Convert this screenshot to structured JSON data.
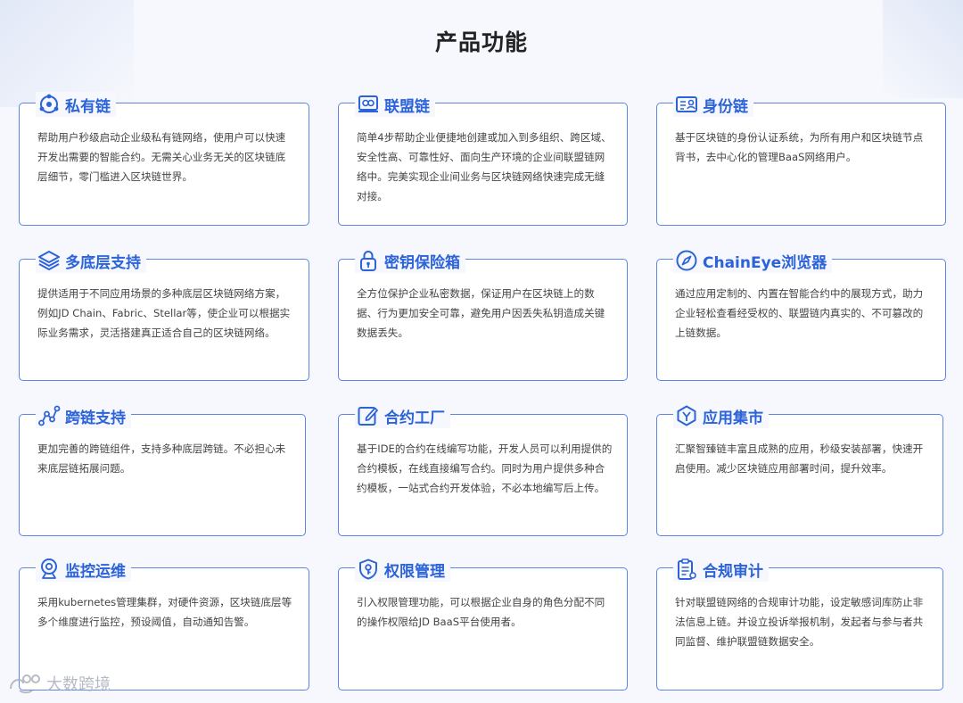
{
  "page": {
    "title": "产品功能"
  },
  "features": [
    {
      "title": "私有链",
      "icon": "private-chain-icon",
      "desc": "帮助用户秒级启动企业级私有链网络，使用户可以快速开发出需要的智能合约。无需关心业务无关的区块链底层细节，零门槛进入区块链世界。"
    },
    {
      "title": "联盟链",
      "icon": "consortium-chain-icon",
      "desc": "简单4步帮助企业便捷地创建或加入到多组织、跨区域、安全性高、可靠性好、面向生产环境的企业间联盟链网络中。完美实现企业间业务与区块链网络快速完成无缝对接。"
    },
    {
      "title": "身份链",
      "icon": "id-card-icon",
      "desc": "基于区块链的身份认证系统，为所有用户和区块链节点背书，去中心化的管理BaaS网络用户。"
    },
    {
      "title": "多底层支持",
      "icon": "layers-icon",
      "desc": "提供适用于不同应用场景的多种底层区块链网络方案，例如JD Chain、Fabric、Stellar等，使企业可以根据实际业务需求，灵活搭建真正适合自己的区块链网络。"
    },
    {
      "title": "密钥保险箱",
      "icon": "lock-icon",
      "desc": "全方位保护企业私密数据，保证用户在区块链上的数据、行为更加安全可靠，避免用户因丢失私钥造成关键数据丢失。"
    },
    {
      "title": "ChainEye浏览器",
      "icon": "compass-icon",
      "desc": "通过应用定制的、内置在智能合约中的展现方式，助力企业轻松查看经受权的、联盟链内真实的、不可篡改的上链数据。"
    },
    {
      "title": "跨链支持",
      "icon": "cross-chain-icon",
      "desc": "更加完善的跨链组件，支持多种底层跨链。不必担心未来底层链拓展问题。"
    },
    {
      "title": "合约工厂",
      "icon": "edit-contract-icon",
      "desc": "基于IDE的合约在线编写功能，开发人员可以利用提供的合约模板，在线直接编写合约。同时为用户提供多种合约模板，一站式合约开发体验，不必本地编写后上传。"
    },
    {
      "title": "应用集市",
      "icon": "app-market-icon",
      "desc": "汇聚智臻链丰富且成熟的应用，秒级安装部署，快速开启使用。减少区块链应用部署时间，提升效率。"
    },
    {
      "title": "监控运维",
      "icon": "monitor-camera-icon",
      "desc": "采用kubernetes管理集群，对硬件资源，区块链底层等多个维度进行监控，预设阈值，自动通知告警。"
    },
    {
      "title": "权限管理",
      "icon": "shield-key-icon",
      "desc": "引入权限管理功能，可以根据企业自身的角色分配不同的操作权限给JD BaaS平台使用者。"
    },
    {
      "title": "合规审计",
      "icon": "audit-clipboard-icon",
      "desc": "针对联盟链网络的合规审计功能，设定敏感词库防止非法信息上链。并设立投诉举报机制，发起者与参与者共同监督、维护联盟链数据安全。"
    }
  ],
  "watermark": {
    "text": "大数跨境"
  },
  "colors": {
    "accent": "#2c63d8",
    "border": "#5c85e6",
    "background": "#f6f8fd"
  }
}
